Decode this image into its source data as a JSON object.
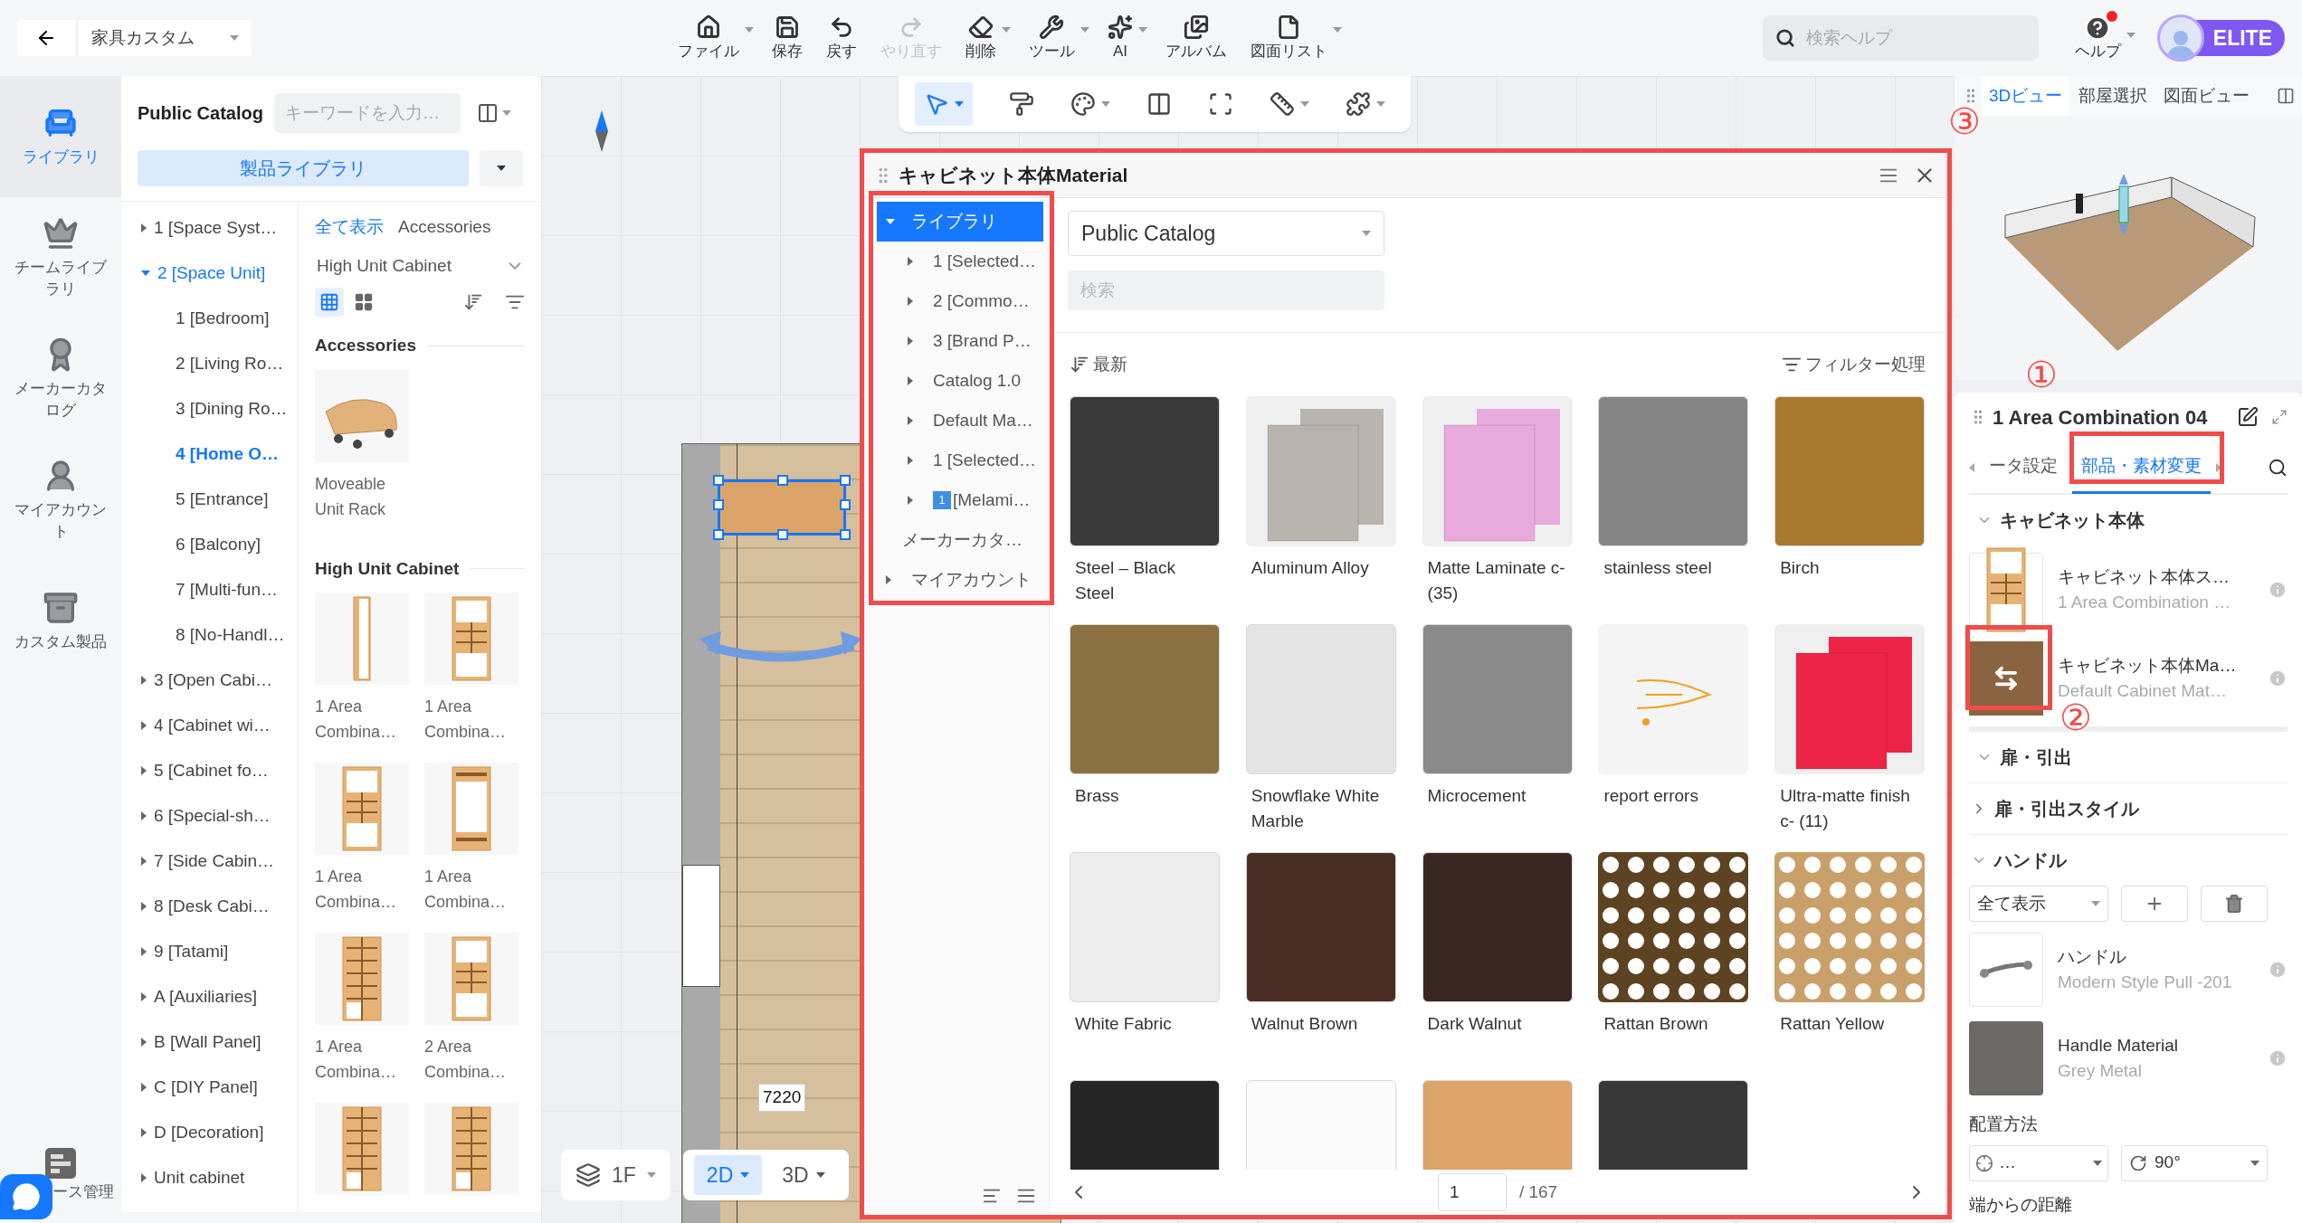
{
  "project_menu": {
    "label": "家具カスタム"
  },
  "toolbar": [
    {
      "label": "ファイル",
      "kind": "file",
      "menu": true,
      "disabled": false
    },
    {
      "label": "保存",
      "kind": "save",
      "menu": false,
      "disabled": false
    },
    {
      "label": "戻す",
      "kind": "undo",
      "menu": false,
      "disabled": false
    },
    {
      "label": "やり直す",
      "kind": "redo",
      "menu": false,
      "disabled": true
    },
    {
      "label": "削除",
      "kind": "eraser",
      "menu": true,
      "disabled": false
    },
    {
      "label": "ツール",
      "kind": "wrench",
      "menu": true,
      "disabled": false
    },
    {
      "label": "AI",
      "kind": "ai",
      "menu": true,
      "disabled": false
    },
    {
      "label": "アルバム",
      "kind": "album",
      "menu": false,
      "disabled": false
    },
    {
      "label": "図面リスト",
      "kind": "drawings",
      "menu": true,
      "disabled": false
    }
  ],
  "help_search": {
    "placeholder": "検索ヘルプ"
  },
  "help": {
    "label": "ヘルプ",
    "notification": true
  },
  "account": {
    "badge": "ELITE"
  },
  "left_rail": {
    "items": [
      {
        "label": "ライブラリ",
        "kind": "sofa",
        "selected": true
      },
      {
        "label": "チームライブラリ",
        "kind": "crown",
        "selected": false
      },
      {
        "label": "メーカーカタログ",
        "kind": "medal",
        "selected": false
      },
      {
        "label": "マイアカウント",
        "kind": "person",
        "selected": false
      },
      {
        "label": "カスタム製品",
        "kind": "cabinet",
        "selected": false
      }
    ],
    "bottom_item": {
      "label": "ース管理"
    }
  },
  "catalog_panel": {
    "title": "Public Catalog",
    "search_placeholder": "キーワードを入力…",
    "library_button": "製品ライブラリ",
    "tree": [
      {
        "label": "1 [Space Syst…",
        "kind": "group",
        "expanded": false,
        "selected": false
      },
      {
        "label": "2 [Space Unit]",
        "kind": "group",
        "expanded": true,
        "selected": false,
        "children": [
          {
            "label": "1 [Bedroom]",
            "kind": "leaf",
            "selected": false
          },
          {
            "label": "2 [Living Ro…",
            "kind": "leaf",
            "selected": false
          },
          {
            "label": "3 [Dining Ro…",
            "kind": "leaf",
            "selected": false
          },
          {
            "label": "4 [Home O…",
            "kind": "leaf",
            "selected": true
          },
          {
            "label": "5 [Entrance]",
            "kind": "leaf",
            "selected": false
          },
          {
            "label": "6 [Balcony]",
            "kind": "leaf",
            "selected": false
          },
          {
            "label": "7 [Multi-fun…",
            "kind": "leaf",
            "selected": false
          },
          {
            "label": "8 [No-Handl…",
            "kind": "leaf",
            "selected": false
          }
        ]
      },
      {
        "label": "3 [Open Cabi…",
        "kind": "group",
        "expanded": false,
        "selected": false
      },
      {
        "label": "4 [Cabinet wi…",
        "kind": "group",
        "expanded": false,
        "selected": false
      },
      {
        "label": "5 [Cabinet fo…",
        "kind": "group",
        "expanded": false,
        "selected": false
      },
      {
        "label": "6 [Special-sh…",
        "kind": "group",
        "expanded": false,
        "selected": false
      },
      {
        "label": "7 [Side Cabin…",
        "kind": "group",
        "expanded": false,
        "selected": false
      },
      {
        "label": "8 [Desk Cabi…",
        "kind": "group",
        "expanded": false,
        "selected": false
      },
      {
        "label": "9 [Tatami]",
        "kind": "group",
        "expanded": false,
        "selected": false
      },
      {
        "label": "A [Auxiliaries]",
        "kind": "group",
        "expanded": false,
        "selected": false
      },
      {
        "label": "B [Wall Panel]",
        "kind": "group",
        "expanded": false,
        "selected": false
      },
      {
        "label": "C [DIY Panel]",
        "kind": "group",
        "expanded": false,
        "selected": false
      },
      {
        "label": "D [Decoration]",
        "kind": "group",
        "expanded": false,
        "selected": false
      },
      {
        "label": "Unit cabinet",
        "kind": "group",
        "expanded": false,
        "selected": false
      }
    ],
    "filters": [
      {
        "label": "全て表示",
        "selected": true
      },
      {
        "label": "Accessories",
        "selected": false
      }
    ],
    "category": "High Unit Cabinet",
    "view_modes": [
      {
        "kind": "small",
        "selected": true
      },
      {
        "kind": "large",
        "selected": false
      }
    ],
    "sections": [
      {
        "title": "Accessories",
        "items": [
          {
            "name": "Moveable Unit Rack",
            "kind": "cart"
          }
        ]
      },
      {
        "title": "High Unit Cabinet",
        "items": [
          {
            "name": "1 Area Combina…",
            "kind": "narrow"
          },
          {
            "name": "1 Area Combina…",
            "kind": "mixed"
          },
          {
            "name": "1 Area Combina…",
            "kind": "mixed"
          },
          {
            "name": "1 Area Combina…",
            "kind": "doors"
          },
          {
            "name": "1 Area Combina…",
            "kind": "open"
          },
          {
            "name": "2 Area Combina…",
            "kind": "mixed"
          },
          {
            "kind": "open"
          },
          {
            "kind": "open"
          }
        ]
      }
    ]
  },
  "floating_toolbar": [
    {
      "kind": "select",
      "selected": true,
      "menu": true
    },
    {
      "kind": "brush",
      "selected": false,
      "menu": false
    },
    {
      "kind": "palette",
      "selected": false,
      "menu": true
    },
    {
      "kind": "split",
      "selected": false,
      "menu": false
    },
    {
      "kind": "frame",
      "selected": false,
      "menu": false
    },
    {
      "kind": "ruler",
      "selected": false,
      "menu": true
    },
    {
      "kind": "puzzle",
      "selected": false,
      "menu": true
    }
  ],
  "plan": {
    "dimension": "7220"
  },
  "floor": {
    "level": "1F",
    "views": [
      {
        "label": "2D",
        "selected": true
      },
      {
        "label": "3D",
        "selected": false
      }
    ]
  },
  "material_dialog": {
    "title": "キャビネット本体Material",
    "tree": [
      {
        "label": "ライブラリ",
        "kind": "group",
        "expanded": true,
        "selected": true,
        "children": [
          {
            "label": "1 [Selected…",
            "kind": "group",
            "expanded": false,
            "selected": false
          },
          {
            "label": "2 [Commo…",
            "kind": "group",
            "expanded": false,
            "selected": false
          },
          {
            "label": "3 [Brand P…",
            "kind": "group",
            "expanded": false,
            "selected": false
          },
          {
            "label": "Catalog 1.0",
            "kind": "group",
            "expanded": false,
            "selected": false
          },
          {
            "label": "Default Ma…",
            "kind": "group",
            "expanded": false,
            "selected": false
          },
          {
            "label": "1 [Selected…",
            "kind": "group",
            "expanded": false,
            "selected": false
          },
          {
            "label": "[Melami…",
            "badge": "1",
            "kind": "group",
            "expanded": false,
            "selected": false
          }
        ]
      },
      {
        "label": "メーカーカタ…",
        "kind": "leaf",
        "selected": false
      },
      {
        "label": "マイアカウント",
        "kind": "group",
        "expanded": false,
        "selected": false
      }
    ],
    "catalog": "Public Catalog",
    "search_placeholder": "検索",
    "sort": "最新",
    "filter": "フィルター処理",
    "materials": [
      {
        "name": "Steel – Black Steel",
        "kind": "flat",
        "color": "#3a3a3a"
      },
      {
        "name": "Aluminum Alloy",
        "kind": "panels",
        "color": "#b9b5ae"
      },
      {
        "name": "Matte Laminate c- (35)",
        "kind": "panels",
        "color": "#e8a9dc"
      },
      {
        "name": "stainless steel",
        "kind": "flat",
        "color": "#858585"
      },
      {
        "name": "Birch",
        "kind": "flat",
        "color": "#a8782e"
      },
      {
        "name": "Brass",
        "kind": "flat",
        "color": "#8c7140"
      },
      {
        "name": "Snowflake White Marble",
        "kind": "flat",
        "color": "#e4e4e4"
      },
      {
        "name": "Microcement",
        "kind": "flat",
        "color": "#8a8a8a"
      },
      {
        "name": "report errors",
        "kind": "notice",
        "color": "#f4f4f4"
      },
      {
        "name": "Ultra-matte finish c- (11)",
        "kind": "panels",
        "color": "#ee2446"
      },
      {
        "name": "White Fabric",
        "kind": "flat",
        "color": "#ececec"
      },
      {
        "name": "Walnut Brown",
        "kind": "flat",
        "color": "#4a2d22"
      },
      {
        "name": "Dark Walnut",
        "kind": "flat",
        "color": "#3a2722"
      },
      {
        "name": "Rattan Brown",
        "kind": "rattan",
        "color": "#5e4322"
      },
      {
        "name": "Rattan Yellow",
        "kind": "rattan",
        "color": "#c9a06a"
      },
      {
        "kind": "flat",
        "color": "#262626"
      },
      {
        "kind": "flat",
        "color": "#fbfbfb"
      },
      {
        "kind": "flat",
        "color": "#dca468"
      },
      {
        "kind": "flat",
        "color": "#383838"
      }
    ],
    "page": "1",
    "page_total": "/ 167"
  },
  "right_panel": {
    "view_tabs": [
      {
        "label": "3Dビュー",
        "selected": true
      },
      {
        "label": "部屋選択",
        "selected": false
      },
      {
        "label": "図面ビュー",
        "selected": false
      }
    ],
    "properties": {
      "title": "1 Area Combination 04",
      "tabs": [
        {
          "label": "ータ設定",
          "selected": false
        },
        {
          "label": "部品・素材変更",
          "selected": true
        }
      ],
      "sections": [
        {
          "title": "キャビネット本体",
          "kind": "heading",
          "expanded": true,
          "items": [
            {
              "title": "キャビネット本体ス…",
              "subtitle": "1 Area Combination …",
              "kind": "cabinet"
            },
            {
              "title": "キャビネット本体Ma…",
              "subtitle": "Default Cabinet Mat…",
              "kind": "swap"
            }
          ]
        },
        {
          "title": "扉・引出",
          "kind": "heading",
          "expanded": true
        },
        {
          "title": "扉・引出スタイル",
          "kind": "sub",
          "expanded": false
        },
        {
          "title": "ハンドル",
          "kind": "sub",
          "expanded": true,
          "filter": "全て表示",
          "items": [
            {
              "title": "ハンドル",
              "subtitle": "Modern Style Pull -201",
              "kind": "handle"
            },
            {
              "title": "Handle Material",
              "subtitle": "Grey Metal",
              "kind": "metal"
            }
          ]
        }
      ],
      "placement": {
        "label": "配置方法",
        "position": "…",
        "rotation": "90°"
      },
      "next_label": "端からの距離"
    }
  },
  "annotations": [
    {
      "label": "①"
    },
    {
      "label": "②"
    },
    {
      "label": "③"
    }
  ]
}
